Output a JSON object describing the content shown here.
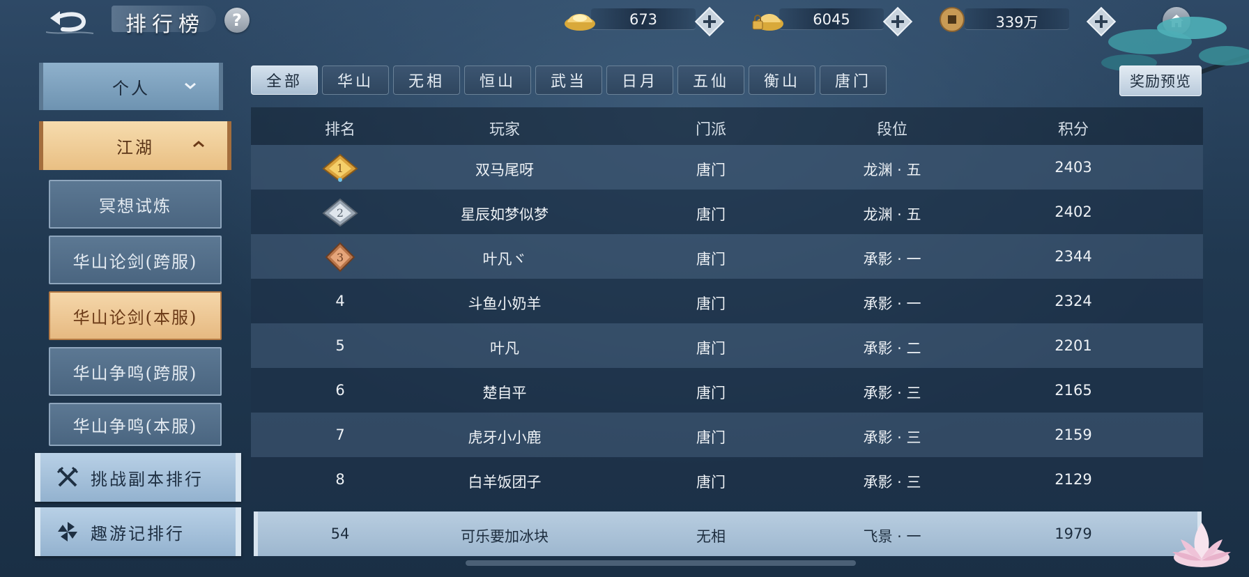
{
  "header": {
    "title": "排行榜",
    "help_label": "?"
  },
  "currencies": [
    {
      "name": "gold-ingot",
      "value": "673"
    },
    {
      "name": "locked-ingot",
      "value": "6045"
    },
    {
      "name": "copper-coin",
      "value": "339万"
    }
  ],
  "sidebar": {
    "personal_label": "个人",
    "jianghu_label": "江湖",
    "sub_items": [
      "冥想试炼",
      "华山论剑(跨服)",
      "华山论剑(本服)",
      "华山争鸣(跨服)",
      "华山争鸣(本服)"
    ],
    "active_sub_index": 2,
    "challenge_label": "挑战副本排行",
    "travel_label": "趣游记排行"
  },
  "tabs": [
    "全部",
    "华山",
    "无相",
    "恒山",
    "武当",
    "日月",
    "五仙",
    "衡山",
    "唐门"
  ],
  "active_tab_index": 0,
  "reward_preview_label": "奖励预览",
  "table": {
    "headers": {
      "rank": "排名",
      "player": "玩家",
      "sect": "门派",
      "tier": "段位",
      "score": "积分"
    },
    "rows": [
      {
        "rank": "1",
        "player": "双马尾呀",
        "sect": "唐门",
        "tier": "龙渊 · 五",
        "score": "2403"
      },
      {
        "rank": "2",
        "player": "星辰如梦似梦",
        "sect": "唐门",
        "tier": "龙渊 · 五",
        "score": "2402"
      },
      {
        "rank": "3",
        "player": "叶凡ヾ",
        "sect": "唐门",
        "tier": "承影 · 一",
        "score": "2344"
      },
      {
        "rank": "4",
        "player": "斗鱼小奶羊",
        "sect": "唐门",
        "tier": "承影 · 一",
        "score": "2324"
      },
      {
        "rank": "5",
        "player": "叶凡",
        "sect": "唐门",
        "tier": "承影 · 二",
        "score": "2201"
      },
      {
        "rank": "6",
        "player": "楚自平",
        "sect": "唐门",
        "tier": "承影 · 三",
        "score": "2165"
      },
      {
        "rank": "7",
        "player": "虎牙小小鹿",
        "sect": "唐门",
        "tier": "承影 · 三",
        "score": "2159"
      },
      {
        "rank": "8",
        "player": "白羊饭团子",
        "sect": "唐门",
        "tier": "承影 · 三",
        "score": "2129"
      }
    ],
    "self": {
      "rank": "54",
      "player": "可乐要加冰块",
      "sect": "无相",
      "tier": "飞景 · 一",
      "score": "1979"
    }
  }
}
